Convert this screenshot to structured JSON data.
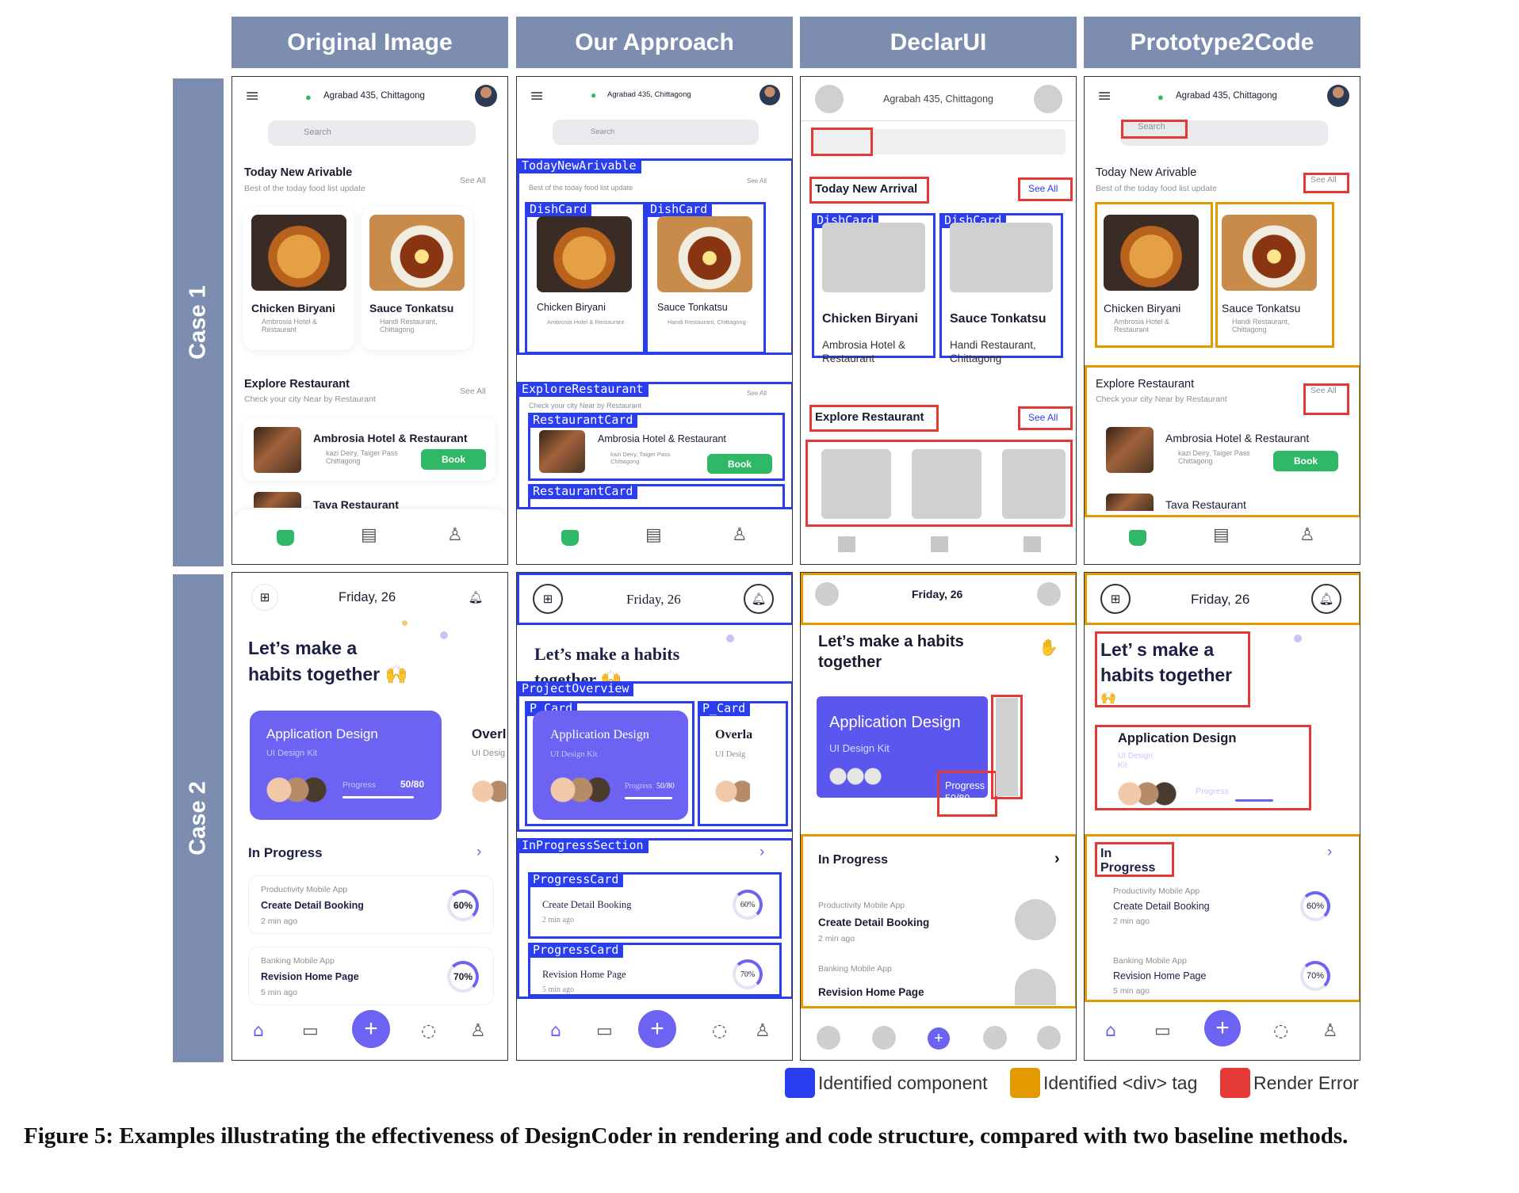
{
  "headers": [
    "Original Image",
    "Our Approach",
    "DeclarUI",
    "Prototype2Code"
  ],
  "cases": [
    "Case 1",
    "Case 2"
  ],
  "case1": {
    "location": "Agrabad 435, Chittagong",
    "location_declarui": "Agrabah 435, Chittagong",
    "search": "Search",
    "today_title": "Today New Arivable",
    "today_title_declarui": "Today New Arrival",
    "today_sub": "Best of the today  food list update",
    "see_all": "See All",
    "dish1_name": "Chicken Biryani",
    "dish1_place": "Ambrosia Hotel & Restaurant",
    "dish2_name": "Sauce Tonkatsu",
    "dish2_place": "Handi Restaurant, Chittagong",
    "explore_title": "Explore Restaurant",
    "explore_sub": "Check your city Near by Restaurant",
    "rest1_name": "Ambrosia Hotel & Restaurant",
    "rest1_addr": "kazi Deiry, Taiger Pass Chittagong",
    "book": "Book",
    "rest2_name": "Tava Restaurant"
  },
  "case2": {
    "date": "Friday, 26",
    "headline_l1": "Let’s make a",
    "headline_l2": "habits together 🙌",
    "headline_ours_l1": "Let’s make a habits",
    "headline_ours_l2": "together 🙌",
    "headline_decl_l1": "Let’s make a habits",
    "headline_decl_l2": "together",
    "headline_p2c_l1": "Let’ s make a",
    "headline_p2c_l2": "habits together",
    "headline_p2c_emoji": "🙌",
    "card_title": "Application Design",
    "card_sub": "UI Design Kit",
    "card_progress": "Progress",
    "card_count": "50/80",
    "card2_title": "Overl",
    "card2_title_ours": "Overla",
    "card2_sub": "UI Desig",
    "in_progress": "In Progress",
    "in_label_p2c_l1": "In",
    "in_label_p2c_l2": "Progress",
    "item1_cat": "Productivity Mobile App",
    "item1_title": "Create Detail Booking",
    "item1_time": "2 min ago",
    "item1_pct": "60%",
    "item2_cat": "Banking Mobile App",
    "item2_title": "Revision Home Page",
    "item2_time": "5 min ago",
    "item2_pct": "70%"
  },
  "labels": {
    "today": "TodayNewArivable",
    "dish": "DishCard",
    "explore": "ExploreRestaurant",
    "rest": "RestaurantCard",
    "project": "ProjectOverview",
    "pcard": "P_Card",
    "inprog": "InProgressSection",
    "progcard": "ProgressCard"
  },
  "legend": {
    "component": "Identified component",
    "div": "Identified <div> tag",
    "error": "Render Error",
    "color_component": "#2a3ef0",
    "color_div": "#e29a00",
    "color_error": "#e53935"
  },
  "caption": "Figure 5: Examples illustrating the effectiveness of DesignCoder in rendering and code structure, compared with two baseline methods."
}
